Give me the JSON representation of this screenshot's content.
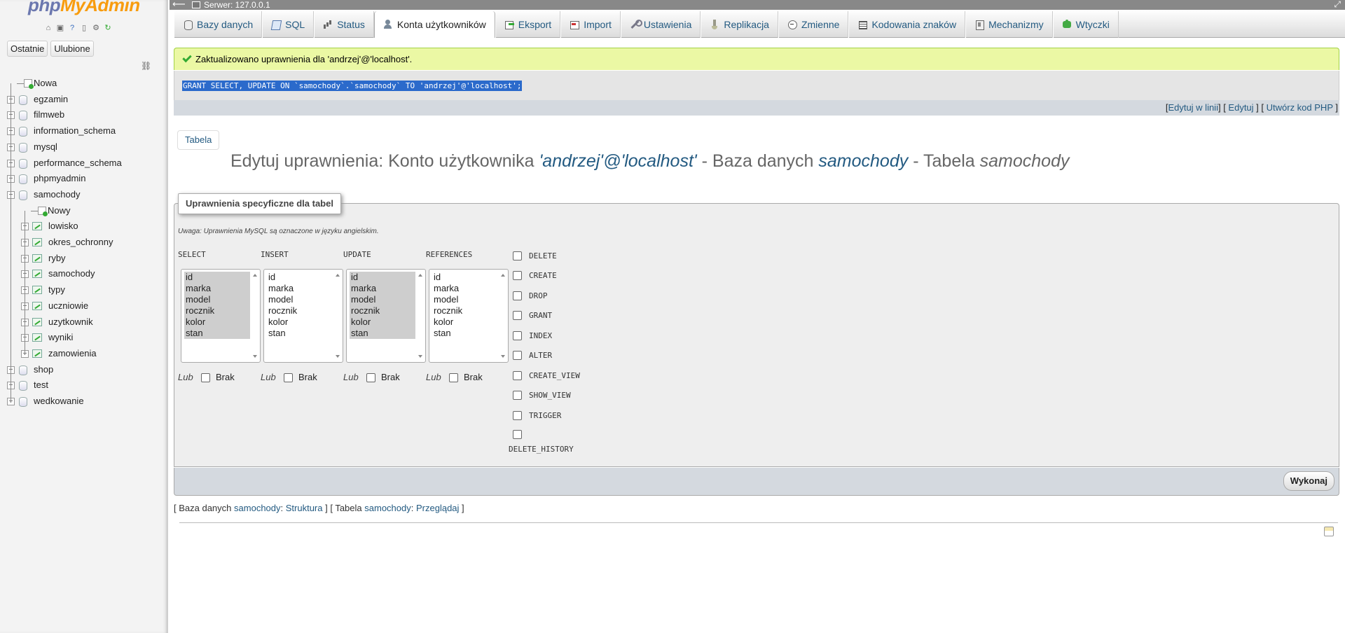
{
  "logo": {
    "php": "php",
    "myadmin": "MyAdmin"
  },
  "nav": {
    "icons": [
      "home-icon",
      "sql-query-icon",
      "help-icon",
      "docs-icon",
      "settings-icon",
      "reload-icon"
    ],
    "tabs": [
      "Ostatnie",
      "Ulubione"
    ],
    "tree": [
      {
        "label": "Nowa",
        "type": "new",
        "level": 0
      },
      {
        "label": "egzamin",
        "type": "db",
        "level": 0
      },
      {
        "label": "filmweb",
        "type": "db",
        "level": 0
      },
      {
        "label": "information_schema",
        "type": "db",
        "level": 0
      },
      {
        "label": "mysql",
        "type": "db",
        "level": 0
      },
      {
        "label": "performance_schema",
        "type": "db",
        "level": 0
      },
      {
        "label": "phpmyadmin",
        "type": "db",
        "level": 0
      },
      {
        "label": "samochody",
        "type": "db-open",
        "level": 0
      },
      {
        "label": "Nowy",
        "type": "new",
        "level": 1
      },
      {
        "label": "lowisko",
        "type": "table",
        "level": 1
      },
      {
        "label": "okres_ochronny",
        "type": "table",
        "level": 1
      },
      {
        "label": "ryby",
        "type": "table",
        "level": 1
      },
      {
        "label": "samochody",
        "type": "table",
        "level": 1
      },
      {
        "label": "typy",
        "type": "table",
        "level": 1
      },
      {
        "label": "uczniowie",
        "type": "table",
        "level": 1
      },
      {
        "label": "uzytkownik",
        "type": "table",
        "level": 1
      },
      {
        "label": "wyniki",
        "type": "table",
        "level": 1
      },
      {
        "label": "zamowienia",
        "type": "table",
        "level": 1
      },
      {
        "label": "shop",
        "type": "db",
        "level": 0
      },
      {
        "label": "test",
        "type": "db",
        "level": 0
      },
      {
        "label": "wedkowanie",
        "type": "db",
        "level": 0
      }
    ]
  },
  "topbar": {
    "server": "Serwer: 127.0.0.1"
  },
  "menu": {
    "tabs": [
      {
        "label": "Bazy danych",
        "icon": "ico-db"
      },
      {
        "label": "SQL",
        "icon": "ico-sql"
      },
      {
        "label": "Status",
        "icon": "ico-status"
      },
      {
        "label": "Konta użytkowników",
        "icon": "ico-user",
        "active": true
      },
      {
        "label": "Eksport",
        "icon": "ico-export"
      },
      {
        "label": "Import",
        "icon": "ico-import"
      },
      {
        "label": "Ustawienia",
        "icon": "ico-wrench"
      },
      {
        "label": "Replikacja",
        "icon": "ico-repl"
      },
      {
        "label": "Zmienne",
        "icon": "ico-var"
      },
      {
        "label": "Kodowania znaków",
        "icon": "ico-charset"
      },
      {
        "label": "Mechanizmy",
        "icon": "ico-engine"
      },
      {
        "label": "Wtyczki",
        "icon": "ico-plugin"
      }
    ]
  },
  "message": {
    "success": "Zaktualizowano uprawnienia dla 'andrzej'@'localhost'.",
    "sql": "GRANT SELECT, UPDATE ON `samochody`.`samochody` TO 'andrzej'@'localhost';",
    "links": {
      "inline": "Edytuj w linii",
      "edit": "Edytuj",
      "php": "Utwórz kod PHP"
    }
  },
  "page": {
    "tab_button": "Tabela",
    "title_prefix": "Edytuj uprawnienia: Konto użytkownika ",
    "title_user": "'andrzej'@'localhost'",
    "title_mid1": " - Baza danych ",
    "title_db": "samochody",
    "title_mid2": " - Tabela ",
    "title_table": "samochody"
  },
  "privileges": {
    "legend": "Uprawnienia specyficzne dla tabel",
    "note": "Uwaga: Uprawnienia MySQL są oznaczone w języku angielskim.",
    "lub": "Lub",
    "brak": "Brak",
    "columns": [
      "id",
      "marka",
      "model",
      "rocznik",
      "kolor",
      "stan"
    ],
    "column_privs": [
      {
        "name": "SELECT",
        "all_selected": true
      },
      {
        "name": "INSERT",
        "all_selected": false
      },
      {
        "name": "UPDATE",
        "all_selected": true
      },
      {
        "name": "REFERENCES",
        "all_selected": false
      }
    ],
    "checkboxes": [
      "DELETE",
      "CREATE",
      "DROP",
      "GRANT",
      "INDEX",
      "ALTER",
      "CREATE_VIEW",
      "SHOW_VIEW",
      "TRIGGER",
      "DELETE_HISTORY"
    ],
    "go_button": "Wykonaj"
  },
  "bottom": {
    "db_label": "Baza danych",
    "db_name": "samochody",
    "db_link": "Struktura",
    "table_label": "Tabela",
    "table_name": "samochody",
    "table_link": "Przeglądaj"
  }
}
